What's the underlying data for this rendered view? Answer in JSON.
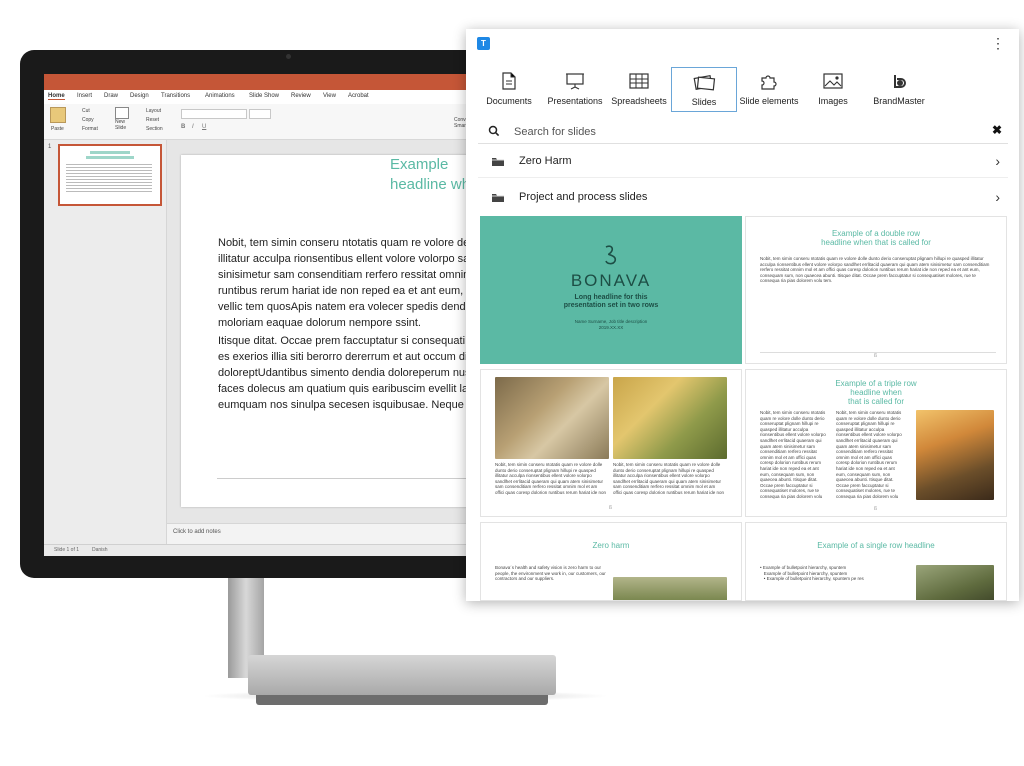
{
  "ppt": {
    "tabs": [
      "Home",
      "Insert",
      "Draw",
      "Design",
      "Transitions",
      "Animations",
      "Slide Show",
      "Review",
      "View",
      "Acrobat"
    ],
    "ribbon": {
      "paste": "Paste",
      "cut": "Cut",
      "copy": "Copy",
      "format": "Format",
      "new_slide": "New\nSlide",
      "layout": "Layout",
      "reset": "Reset",
      "section": "Section",
      "convert": "Conve\nSmar"
    },
    "thumb_number": "1",
    "slide_title": "Example\nheadline wh",
    "slide_body_1": "Nobit, tem simin conseru ntotatis quam re volore de\nillitatur acculpa rionsentibus ellent volore volorpo sa\nsinisimetur sam consenditiam rerfero ressitat omnim\nruntibus rerum hariat ide non reped ea et ant eum,\nvellic tem quosApis natem era volecer spedis dendit\nmoloriam eaquae dolorum nempore ssint.",
    "slide_body_2": "Itisque ditat. Occae prem faccuptatur si consequati\nes exerios illia siti berorro dererrum et aut occum di\ndoloreptUdantibus simento dendia doloreperum nus\nfaces dolecus am quatium quis earibuscim evellit la\neumquam nos sinulpa secesen isquibusae. Neque se",
    "notes": "Click to add notes",
    "status_slide": "Slide 1 of 1",
    "status_lang": "Danish"
  },
  "panel": {
    "logo": "T",
    "tabs": [
      {
        "label": "Documents",
        "icon": "document-icon"
      },
      {
        "label": "Presentations",
        "icon": "presentation-icon"
      },
      {
        "label": "Spreadsheets",
        "icon": "spreadsheet-icon"
      },
      {
        "label": "Slides",
        "icon": "slides-icon"
      },
      {
        "label": "Slide elements",
        "icon": "puzzle-icon"
      },
      {
        "label": "Images",
        "icon": "image-icon"
      },
      {
        "label": "BrandMaster",
        "icon": "brandmaster-icon"
      }
    ],
    "active_tab": "Slides",
    "search_placeholder": "Search for slides",
    "folders": [
      {
        "label": "Zero Harm"
      },
      {
        "label": "Project and process slides"
      }
    ],
    "cards": {
      "cover": {
        "brand": "BONAVA",
        "headline": "Long headline for this\npresentation set in two rows",
        "meta": "Name Surname, Job title description\n2019.XX.XX"
      },
      "double": {
        "title": "Example of a double row\nheadline when that is called for"
      },
      "triple": {
        "title": "Example of a triple row\nheadline when\nthat is called for"
      },
      "zero": {
        "title": "Zero harm",
        "body": "Bonava´s health and safety vision is zero harm to our\npeople, the environment we work in, our customers, our\ncontractors and our suppliers."
      },
      "single": {
        "title": "Example of a single row headline",
        "bullets": "• Example of bulletpoint hierarchy, spuntem\n   Example of bulletpoint hierarchy, spuntem\n   • Example of bulletpoint hierarchy, spuntem pe res"
      }
    },
    "lorem": "Nobit, tem simin conseru ntotatis quam re volore dolle dunto derio conseruptat plignam hillupi re quasped illitatur acculpa rionsentibus ellent volore volorpo sandlhet errlitacid quaeram qui quam atem sinisimetur sam consenditiam rerfero ressitat omnim mol et am offici quas coresp dolorion runtibus rerum hariat ide non reped ea et ant eum, consequam sum, non quaecea abunti. Itisque ditat. Occae prem faccuptatur si consequatiset molores, rue te consequa ria pias dolorem volu tem."
  }
}
